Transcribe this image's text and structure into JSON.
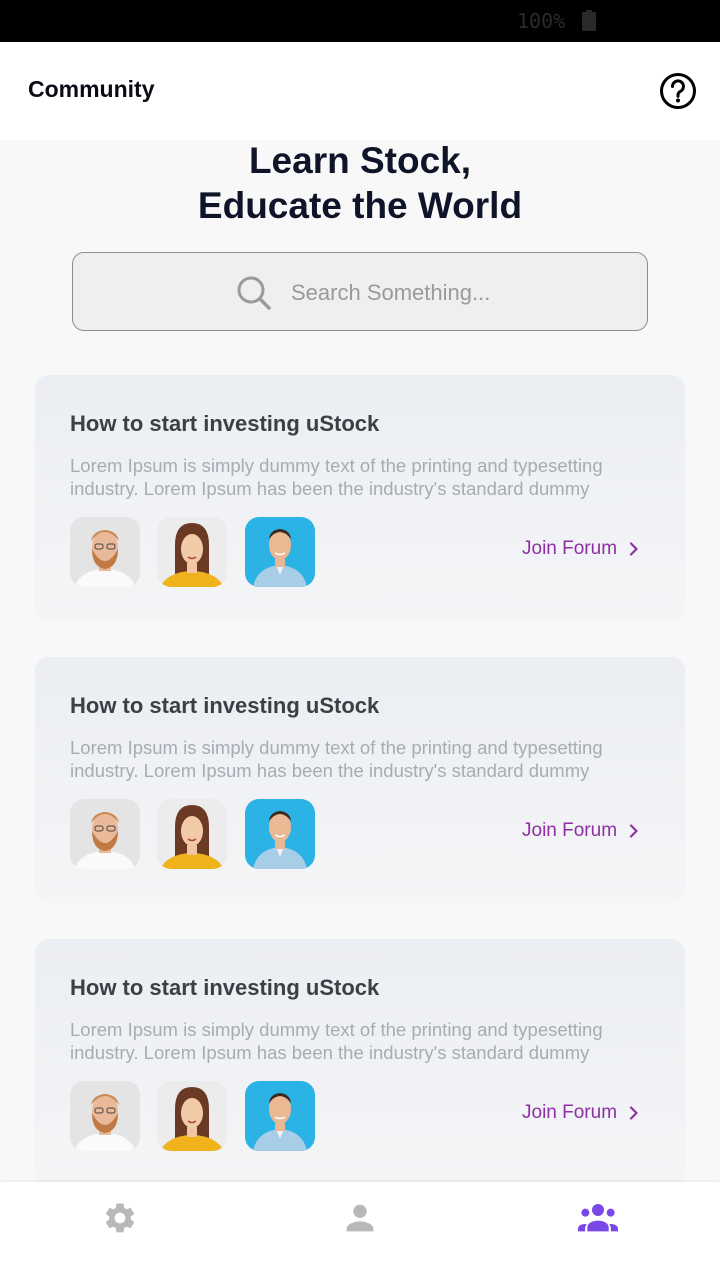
{
  "status_bar": {
    "battery_text": "100%"
  },
  "app_bar": {
    "title": "Community",
    "help_icon": "help-circle-icon"
  },
  "hero": {
    "line1": "Learn Stock,",
    "line2": "Educate the World"
  },
  "search": {
    "placeholder": "Search Something...",
    "value": ""
  },
  "forums": [
    {
      "title": "How to start investing uStock",
      "description": "Lorem Ipsum is simply dummy text of the printing and typesetting industry. Lorem Ipsum has been the industry's standard dummy",
      "join_label": "Join Forum"
    },
    {
      "title": "How to start investing uStock",
      "description": "Lorem Ipsum is simply dummy text of the printing and typesetting industry. Lorem Ipsum has been the industry's standard dummy",
      "join_label": "Join Forum"
    },
    {
      "title": "How to start investing uStock",
      "description": "Lorem Ipsum is simply dummy text of the printing and typesetting industry. Lorem Ipsum has been the industry's standard dummy",
      "join_label": "Join Forum"
    }
  ],
  "bottom_nav": {
    "items": [
      {
        "icon": "gear-icon",
        "active": false
      },
      {
        "icon": "person-icon",
        "active": false
      },
      {
        "icon": "people-icon",
        "active": true
      }
    ]
  },
  "colors": {
    "accent": "#8e2fa3",
    "nav_active": "#7a48e8",
    "nav_inactive": "#b8b8b8",
    "title": "#0f1428"
  }
}
